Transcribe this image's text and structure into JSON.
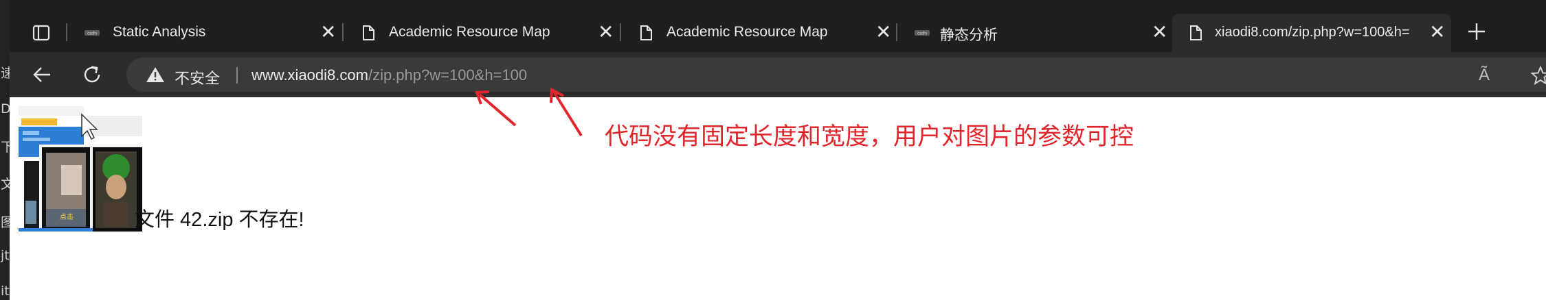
{
  "left_strip": {
    "glyphs": [
      "速",
      "De",
      "下",
      "文",
      "图",
      "jt",
      "it"
    ]
  },
  "tabs": [
    {
      "title": "Static Analysis",
      "favicon": "site-logo-icon",
      "close": "✕"
    },
    {
      "title": "Academic Resource Map",
      "favicon": "page-icon",
      "close": "✕"
    },
    {
      "title": "Academic Resource Map",
      "favicon": "page-icon",
      "close": "✕"
    },
    {
      "title": "静态分析",
      "favicon": "site-logo-icon",
      "close": "✕"
    },
    {
      "title": "xiaodi8.com/zip.php?w=100&h=",
      "favicon": "page-icon",
      "close": "✕",
      "active": true
    }
  ],
  "toolbar": {
    "security_label": "不安全",
    "url_host": "www.xiaodi8.com",
    "url_path": "/zip.php?w=100&h=100",
    "read_aloud": "Ã"
  },
  "page": {
    "error_text": "文件 42.zip 不存在!",
    "annotation": "代码没有固定长度和宽度，用户对图片的参数可控",
    "thumbnail_caption": "点击"
  },
  "colors": {
    "annotation": "#e2252b",
    "chrome_dark": "#1f1f1f",
    "toolbar": "#2c2c2c",
    "omnibox": "#3a3a3a"
  }
}
